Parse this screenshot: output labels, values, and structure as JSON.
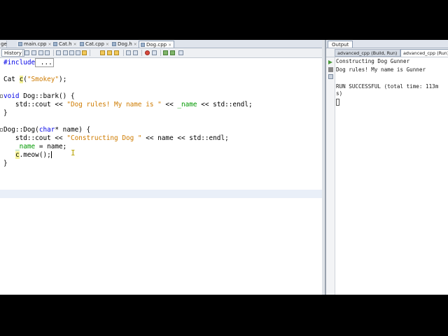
{
  "editor": {
    "tabs": [
      {
        "label": "ge",
        "active": false
      },
      {
        "label": "main.cpp",
        "active": false
      },
      {
        "label": "Cat.h",
        "active": false
      },
      {
        "label": "Cat.cpp",
        "active": false
      },
      {
        "label": "Dog.h",
        "active": false
      },
      {
        "label": "Dog.cpp",
        "active": true
      }
    ],
    "history_label": "History",
    "code": {
      "include_kw": "#include",
      "include_rest": " ...",
      "cat_type": "Cat ",
      "cat_var": "c",
      "cat_open": "(",
      "cat_str": "\"Smokey\"",
      "cat_close": ");",
      "bark_kw": "void",
      "bark_rest": " Dog::bark() {",
      "cout1_pre": "   std::cout << ",
      "cout1_str": "\"Dog rules! My name is \"",
      "cout1_mid": " << ",
      "cout1_field": "_name",
      "cout1_post": " << std::endl;",
      "close1": "}",
      "ctor_pre": "Dog::Dog(",
      "ctor_kw": "char",
      "ctor_post": "* name) {",
      "cout2_pre": "   std::cout << ",
      "cout2_str": "\"Constructing Dog \"",
      "cout2_post": " << name << std::endl;",
      "assign_field": "_name",
      "assign_rest": " = name;",
      "meow_var": "c",
      "meow_rest": ".meow();",
      "close2": "}"
    }
  },
  "output": {
    "title": "Output",
    "tabs": [
      {
        "label": "advanced_cpp (Build, Run)",
        "active": false
      },
      {
        "label": "advanced_cpp (Run) ×",
        "active": true
      }
    ],
    "lines": [
      "Constructing Dog Gunner",
      "Dog rules! My name is Gunner",
      "",
      "RUN SUCCESSFUL (total time: 113m",
      "s)"
    ]
  },
  "colors": {
    "keyword": "#0000e6",
    "string": "#ce7b00",
    "field": "#009900",
    "current_line": "#e9eff8"
  }
}
